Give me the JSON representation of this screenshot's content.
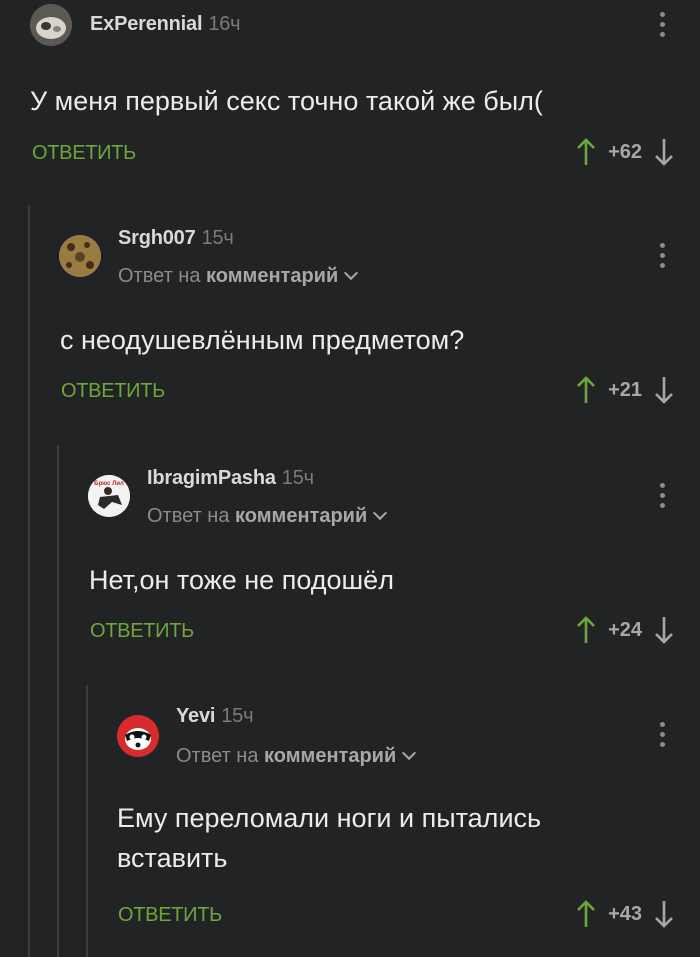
{
  "comments": [
    {
      "author": "ExPerennial",
      "time": "16ч",
      "text": "У меня первый секс точно такой же был(",
      "reply_label": "ОТВЕТИТЬ",
      "votes": "+62"
    },
    {
      "author": "Srgh007",
      "time": "15ч",
      "reply_prefix": "Ответ на",
      "reply_target": "комментарий",
      "text": "с неодушевлённым предметом?",
      "reply_label": "ОТВЕТИТЬ",
      "votes": "+21"
    },
    {
      "author": "IbragimPasha",
      "time": "15ч",
      "reply_prefix": "Ответ на",
      "reply_target": "комментарий",
      "text": "Нет,он тоже не подошёл",
      "reply_label": "ОТВЕТИТЬ",
      "votes": "+24",
      "avatar_text": "Брюс Лил"
    },
    {
      "author": "Yevi",
      "time": "15ч",
      "reply_prefix": "Ответ на",
      "reply_target": "комментарий",
      "text_line1": "Ему переломали ноги и пытались",
      "text_line2": "вставить",
      "reply_label": "ОТВЕТИТЬ",
      "votes": "+43"
    }
  ],
  "colors": {
    "background": "#222324",
    "reply_green": "#6da73c",
    "arrow_up": "#6da73c",
    "arrow_down": "#a7a8aa"
  }
}
